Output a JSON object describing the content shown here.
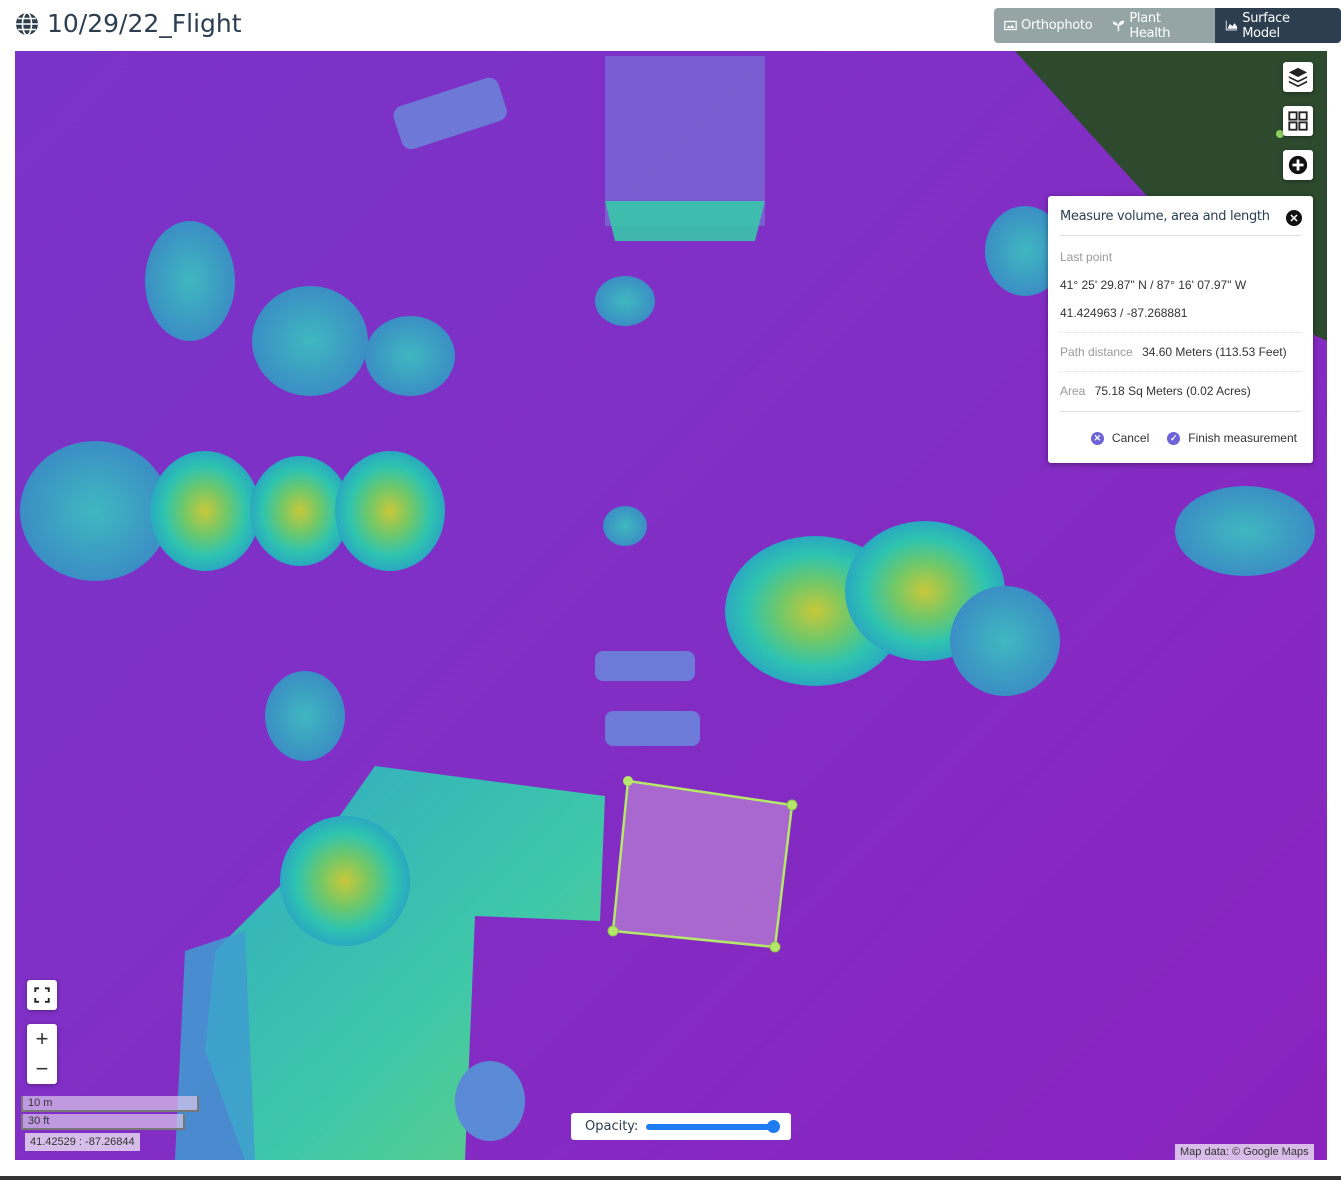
{
  "header": {
    "title": "10/29/22_Flight",
    "title_icon": "globe-icon",
    "modes": [
      {
        "label": "Orthophoto",
        "icon": "image-icon",
        "active": false
      },
      {
        "label": "Plant Health",
        "icon": "seedling-icon",
        "active": false
      },
      {
        "label": "Surface Model",
        "icon": "area-chart-icon",
        "active": true
      }
    ]
  },
  "map_controls": {
    "layers_icon": "layers-icon",
    "grid_icon": "grid-icon",
    "add_icon": "plus-circle-icon",
    "fullscreen_icon": "fullscreen-icon",
    "zoom_in": "+",
    "zoom_out": "−"
  },
  "measure_panel": {
    "title": "Measure volume, area and length",
    "last_point_label": "Last point",
    "dms": "41° 25' 29.87\" N / 87° 16' 07.97\" W",
    "decimal": "41.424963 / -87.268881",
    "path_distance_label": "Path distance",
    "path_distance_value": "34.60 Meters (113.53 Feet)",
    "area_label": "Area",
    "area_value": "75.18 Sq Meters (0.02 Acres)",
    "cancel_label": "Cancel",
    "finish_label": "Finish measurement",
    "accent_color": "#6c63d6"
  },
  "scale": {
    "metric": "10 m",
    "imperial": "30 ft"
  },
  "cursor_coords": "41.42529 : -87.26844",
  "opacity": {
    "label": "Opacity:",
    "value_percent": 100
  },
  "attribution": "Map data: © Google Maps",
  "measurement_polygon": {
    "stroke_color": "#b5e86a",
    "fill_color": "#c79bd8"
  }
}
